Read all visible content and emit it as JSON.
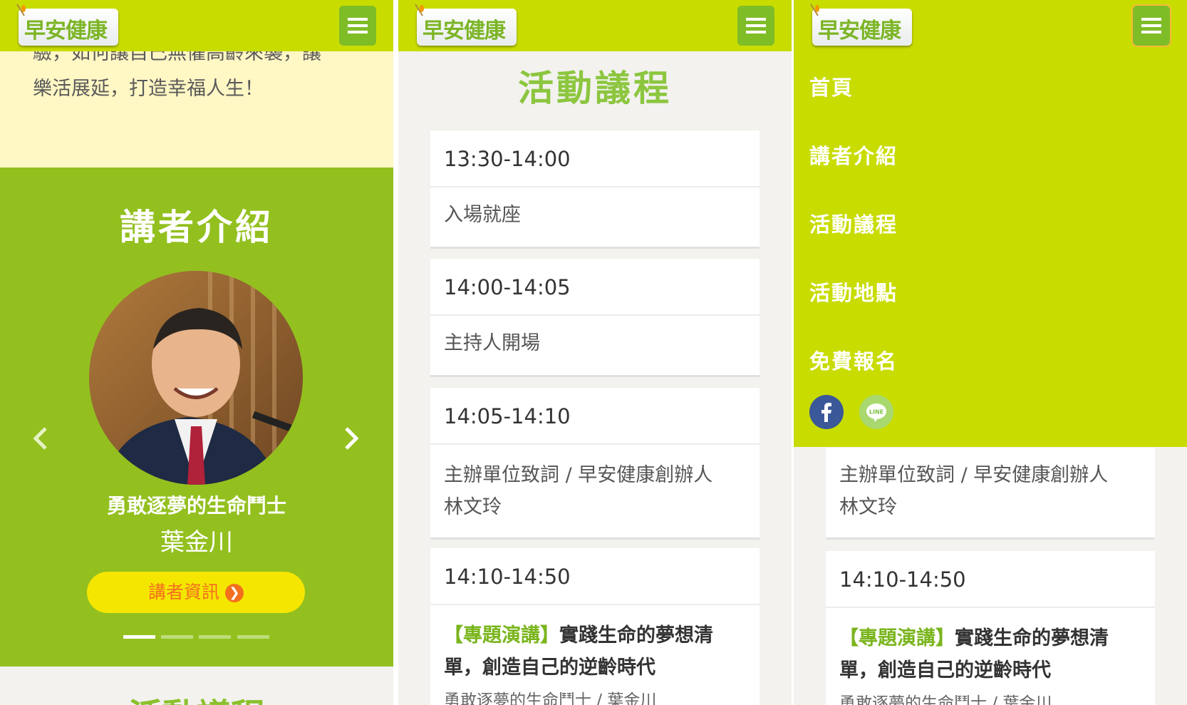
{
  "brand": {
    "logo_text": "早安健康"
  },
  "panel1": {
    "intro_text": "驗，如何讓自己無懼高齡來襲，讓\n樂活展延，打造幸福人生！",
    "section_title": "講者介紹",
    "speaker": {
      "tagline": "勇敢逐夢的生命鬥士",
      "name": "葉金川",
      "info_button": "講者資訊"
    },
    "carousel": {
      "total": 4,
      "active": 1
    },
    "next_section_title": "活動議程"
  },
  "agenda": {
    "title": "活動議程",
    "items": [
      {
        "time": "13:30-14:00",
        "desc": "入場就座"
      },
      {
        "time": "14:00-14:05",
        "desc": "主持人開場"
      },
      {
        "time": "14:05-14:10",
        "desc": "主辦單位致詞 / 早安健康創辦人",
        "desc2": "林文玲"
      },
      {
        "time": "14:10-14:50",
        "tag": "【專題演講】",
        "talk": "實踐生命的夢想清單，創造自己的逆齡時代",
        "speaker_line": "勇敢逐夢的生命鬥士 / 葉金川"
      }
    ]
  },
  "menu": {
    "items": [
      "首頁",
      "講者介紹",
      "活動議程",
      "活動地點",
      "免費報名"
    ],
    "social": [
      "facebook-icon",
      "line-icon"
    ]
  },
  "colors": {
    "topbar": "#c8dc00",
    "section_green": "#93c01f",
    "accent_green": "#8cc63f",
    "menu_btn": "#7fbd27",
    "button_yellow": "#f5e600",
    "button_text": "#f36f1e"
  }
}
